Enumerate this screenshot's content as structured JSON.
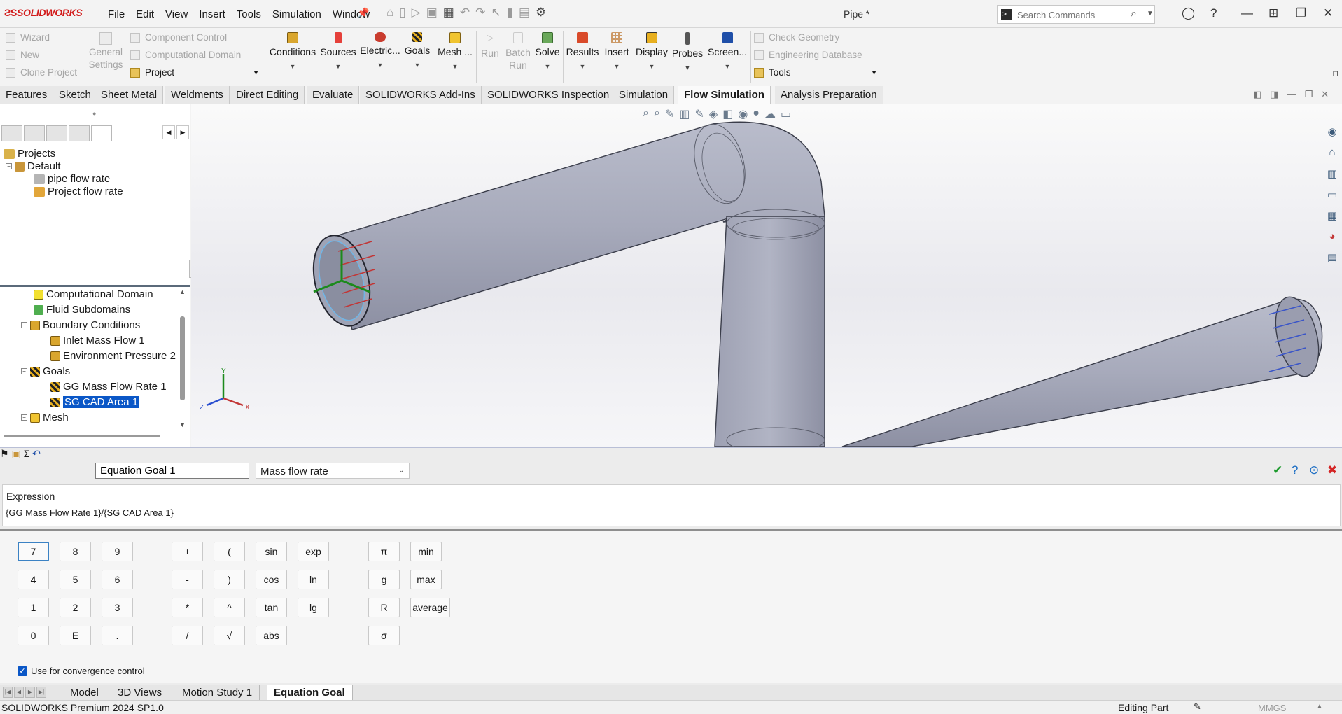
{
  "app": {
    "logo": "SOLIDWORKS",
    "doc_title": "Pipe *"
  },
  "menu": [
    "File",
    "Edit",
    "View",
    "Insert",
    "Tools",
    "Simulation",
    "Window"
  ],
  "search": {
    "placeholder": "Search Commands"
  },
  "command_manager": {
    "left_items": [
      "Wizard",
      "New",
      "Clone Project"
    ],
    "settings_label": "General Settings",
    "domain_items": [
      "Component Control",
      "Computational Domain",
      "Project"
    ],
    "buttons": [
      "Conditions",
      "Sources",
      "Electric...",
      "Goals",
      "Mesh ...",
      "Run",
      "Batch Run",
      "Solve",
      "Results",
      "Insert",
      "Display",
      "Probes",
      "Screen..."
    ],
    "right_items": [
      "Check Geometry",
      "Engineering Database",
      "Tools"
    ]
  },
  "tabs": [
    "Features",
    "Sketch",
    "Sheet Metal",
    "Weldments",
    "Direct Editing",
    "Evaluate",
    "SOLIDWORKS Add-Ins",
    "SOLIDWORKS Inspection",
    "Simulation",
    "Flow Simulation",
    "Analysis Preparation"
  ],
  "active_tab": "Flow Simulation",
  "projects_tree": {
    "root": "Projects",
    "default": "Default",
    "items": [
      "pipe flow rate",
      "Project flow rate"
    ]
  },
  "analysis_tree": {
    "items": [
      "Computational Domain",
      "Fluid Subdomains",
      "Boundary Conditions",
      "Inlet Mass Flow 1",
      "Environment Pressure 2",
      "Goals",
      "GG Mass Flow Rate 1",
      "SG CAD Area 1",
      "Mesh"
    ]
  },
  "triad": {
    "x": "X",
    "y": "Y",
    "z": "Z"
  },
  "equation_goal": {
    "name": "Equation Goal 1",
    "dimensionality": "Mass flow rate",
    "expression_label": "Expression",
    "expression": "{GG Mass Flow Rate 1}/{SG CAD Area 1}",
    "keypad": {
      "digits": [
        "7",
        "8",
        "9",
        "4",
        "5",
        "6",
        "1",
        "2",
        "3",
        "0",
        "E",
        "."
      ],
      "ops": [
        "+",
        "(",
        "sin",
        "exp",
        "-",
        ")",
        "cos",
        "ln",
        "*",
        "^",
        "tan",
        "lg",
        "/",
        "√",
        "abs"
      ],
      "consts": [
        "π",
        "g",
        "R",
        "σ"
      ],
      "funcs": [
        "min",
        "max",
        "average"
      ]
    },
    "convergence_label": "Use for convergence control"
  },
  "bottom_tabs": [
    "Model",
    "3D Views",
    "Motion Study 1",
    "Equation Goal"
  ],
  "active_bottom_tab": "Equation Goal",
  "status": {
    "product": "SOLIDWORKS Premium 2024 SP1.0",
    "mode": "Editing Part",
    "units": "MMGS"
  }
}
